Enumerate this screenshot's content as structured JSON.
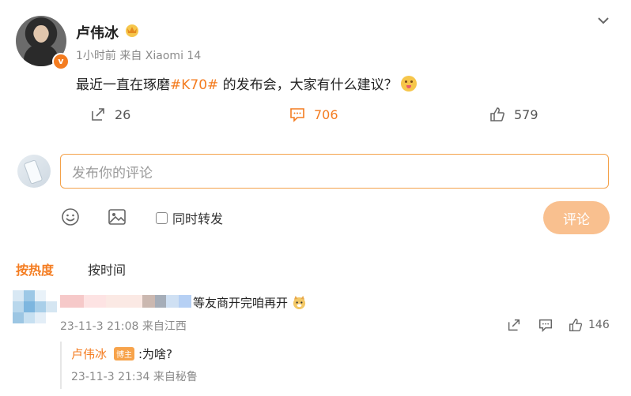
{
  "post": {
    "author": "卢伟冰",
    "meta": "1小时前 来自 Xiaomi 14",
    "text_before": "最近一直在琢磨",
    "tag": "#K70#",
    "text_after": " 的发布会，大家有什么建议？"
  },
  "stats": {
    "repost": "26",
    "comment": "706",
    "like": "579"
  },
  "composer": {
    "placeholder": "发布你的评论",
    "also_repost": "同时转发",
    "submit": "评论"
  },
  "sort": {
    "hot": "按热度",
    "time": "按时间"
  },
  "comments": [
    {
      "text": "等友商开完咱再开",
      "meta": "23-11-3 21:08 来自江西",
      "likes": "146",
      "reply": {
        "name": "卢伟冰",
        "badge": "博主",
        "text": ":为啥?",
        "meta": "23-11-3 21:34 来自秘鲁"
      }
    }
  ],
  "colors": {
    "accent": "#f47c20",
    "submit_bg": "#f9c08f",
    "border_focus": "#f4a24a"
  },
  "icons": [
    "crown-icon",
    "chevron-down-icon",
    "repost-icon",
    "comment-icon",
    "like-icon",
    "emoji-icon",
    "image-icon"
  ]
}
